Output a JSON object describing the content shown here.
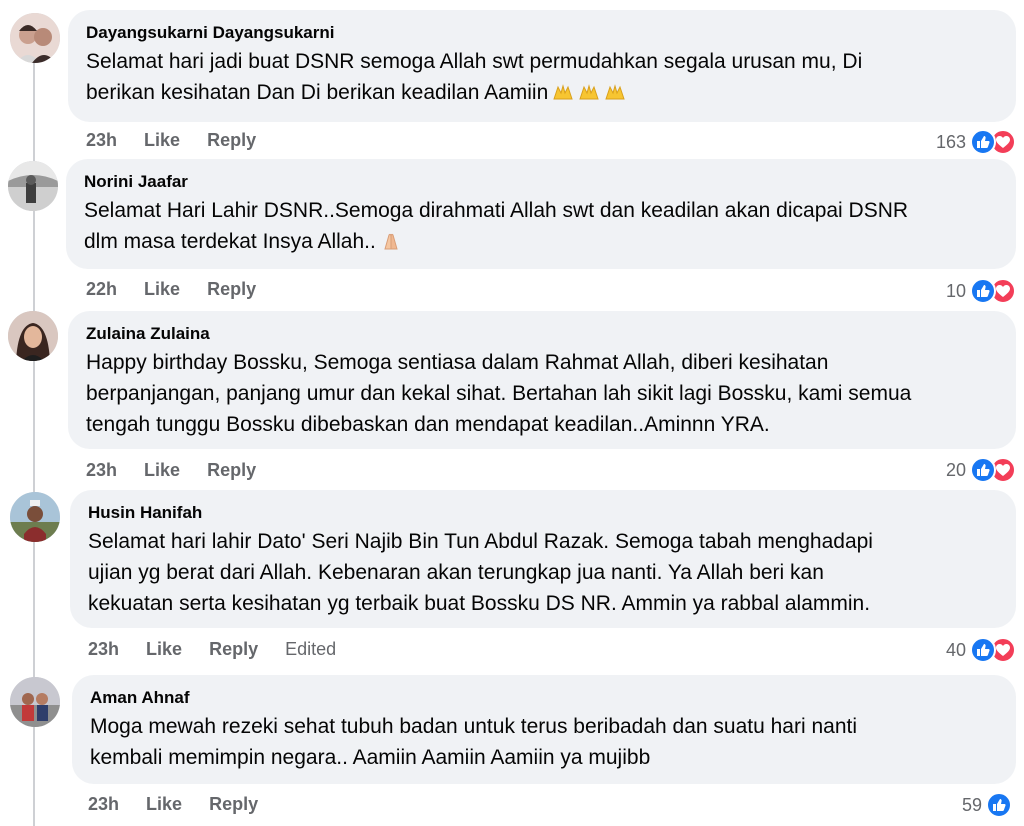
{
  "colors": {
    "bubble_bg": "#f0f2f5",
    "meta_text": "#65676b",
    "like_blue": "#1877f2",
    "love_red": "#f33e58",
    "thread_line": "#ced0d4"
  },
  "comments": [
    {
      "author": "Dayangsukarni Dayangsukarni",
      "text": "Selamat hari jadi buat DSNR semoga Allah swt permudahkan segala urusan mu, Di\nberikan kesihatan Dan Di berikan keadilan Aamiin",
      "emoji_icons": [
        "raising-hands-icon",
        "raising-hands-icon",
        "raising-hands-icon"
      ],
      "time": "23h",
      "like_label": "Like",
      "reply_label": "Reply",
      "reaction_count": "163",
      "reactions": [
        "like-icon",
        "love-icon"
      ]
    },
    {
      "author": "Norini Jaafar",
      "text": "Selamat Hari Lahir DSNR..Semoga dirahmati Allah swt dan keadilan akan dicapai DSNR\ndlm masa terdekat Insya Allah..",
      "emoji_icons": [
        "praying-hands-icon"
      ],
      "time": "22h",
      "like_label": "Like",
      "reply_label": "Reply",
      "reaction_count": "10",
      "reactions": [
        "like-icon",
        "love-icon"
      ]
    },
    {
      "author": "Zulaina Zulaina",
      "text": "Happy birthday Bossku, Semoga sentiasa dalam Rahmat Allah, diberi kesihatan\nberpanjangan, panjang umur dan kekal sihat. Bertahan lah sikit lagi Bossku, kami semua\ntengah tunggu Bossku dibebaskan dan mendapat keadilan..Aminnn YRA.",
      "emoji_icons": [],
      "time": "23h",
      "like_label": "Like",
      "reply_label": "Reply",
      "reaction_count": "20",
      "reactions": [
        "like-icon",
        "love-icon"
      ]
    },
    {
      "author": "Husin Hanifah",
      "text": "Selamat hari lahir Dato' Seri Najib Bin Tun Abdul Razak. Semoga tabah menghadapi\nujian yg berat dari Allah. Kebenaran akan terungkap jua nanti. Ya Allah beri kan\nkekuatan serta kesihatan yg terbaik buat Bossku DS NR. Ammin ya rabbal alammin.",
      "emoji_icons": [],
      "time": "23h",
      "like_label": "Like",
      "reply_label": "Reply",
      "edited_label": "Edited",
      "reaction_count": "40",
      "reactions": [
        "like-icon",
        "love-icon"
      ]
    },
    {
      "author": "Aman Ahnaf",
      "text": "Moga mewah rezeki sehat tubuh badan untuk terus beribadah dan suatu hari nanti\nkembali memimpin negara.. Aamiin Aamiin Aamiin ya mujibb",
      "emoji_icons": [],
      "time": "23h",
      "like_label": "Like",
      "reply_label": "Reply",
      "reaction_count": "59",
      "reactions": [
        "like-icon"
      ]
    }
  ]
}
